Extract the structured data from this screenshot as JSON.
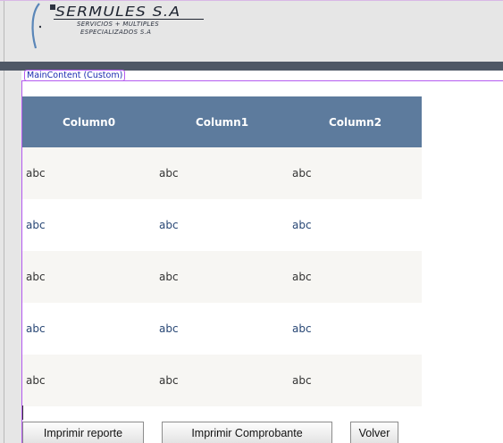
{
  "header": {
    "logo_title": "SERMULES S.A",
    "logo_subtitle_line1": "SERVICIOS + MULTIPLES",
    "logo_subtitle_line2": "ESPECIALIZADOS S.A"
  },
  "content": {
    "region_tag": "MainContent (Custom)"
  },
  "grid": {
    "columns": [
      "Column0",
      "Column1",
      "Column2"
    ],
    "rows": [
      [
        "abc",
        "abc",
        "abc"
      ],
      [
        "abc",
        "abc",
        "abc"
      ],
      [
        "abc",
        "abc",
        "abc"
      ],
      [
        "abc",
        "abc",
        "abc"
      ],
      [
        "abc",
        "abc",
        "abc"
      ]
    ],
    "header_color": "#5d7b9d",
    "odd_row_color": "#f7f6f3",
    "even_row_text_color": "#284775"
  },
  "buttons": {
    "print_report": "Imprimir reporte",
    "print_receipt": "Imprimir Comprobante",
    "back": "Volver"
  }
}
